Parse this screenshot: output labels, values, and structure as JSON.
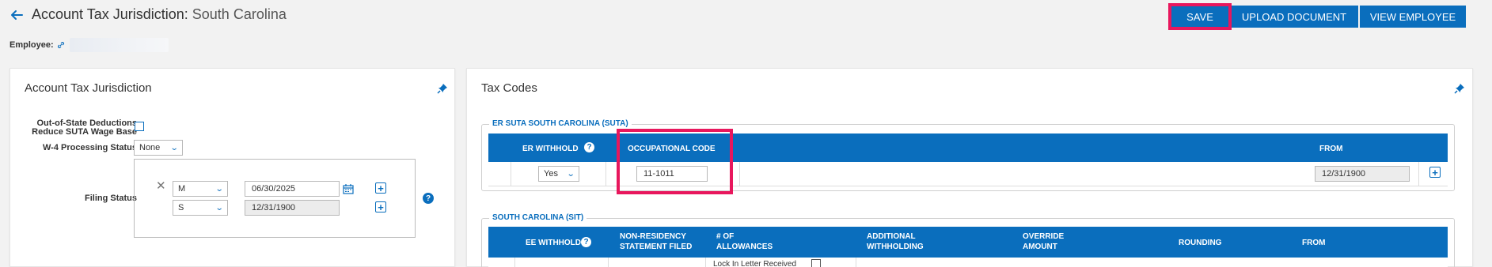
{
  "header": {
    "title_prefix": "Account Tax Jurisdiction:",
    "jurisdiction": "South Carolina",
    "employee_label": "Employee:"
  },
  "toolbar": {
    "save": "SAVE",
    "upload": "UPLOAD DOCUMENT",
    "view": "VIEW EMPLOYEE"
  },
  "left_panel": {
    "title": "Account Tax Jurisdiction",
    "oos_label_1": "Out-of-State Deductions",
    "oos_label_2": "Reduce SUTA Wage Base",
    "w4_label": "W-4 Processing Status",
    "w4_value": "None",
    "filing_label": "Filing Status",
    "filing_rows": [
      {
        "status": "M",
        "date": "06/30/2025"
      },
      {
        "status": "S",
        "date": "12/31/1900"
      }
    ]
  },
  "right_panel": {
    "title": "Tax Codes",
    "suta": {
      "title": "ER SUTA SOUTH CAROLINA (SUTA)",
      "col_withhold": "ER WITHHOLD",
      "col_occ": "OCCUPATIONAL CODE",
      "col_from": "FROM",
      "withhold_value": "Yes",
      "occ_value": "11-1011",
      "from_value": "12/31/1900"
    },
    "sit": {
      "title": "SOUTH CAROLINA (SIT)",
      "col_ee": "EE WITHHOLD",
      "col_nonres_1": "NON-RESIDENCY",
      "col_nonres_2": "STATEMENT FILED",
      "col_allow_1": "# OF",
      "col_allow_2": "ALLOWANCES",
      "col_addl_1": "ADDITIONAL",
      "col_addl_2": "WITHHOLDING",
      "col_override_1": "OVERRIDE",
      "col_override_2": "AMOUNT",
      "col_rounding": "ROUNDING",
      "col_from": "FROM",
      "lock_in": "Lock In Letter Received"
    }
  },
  "colors": {
    "accent": "#0a6ebd",
    "highlight": "#e8175d"
  }
}
